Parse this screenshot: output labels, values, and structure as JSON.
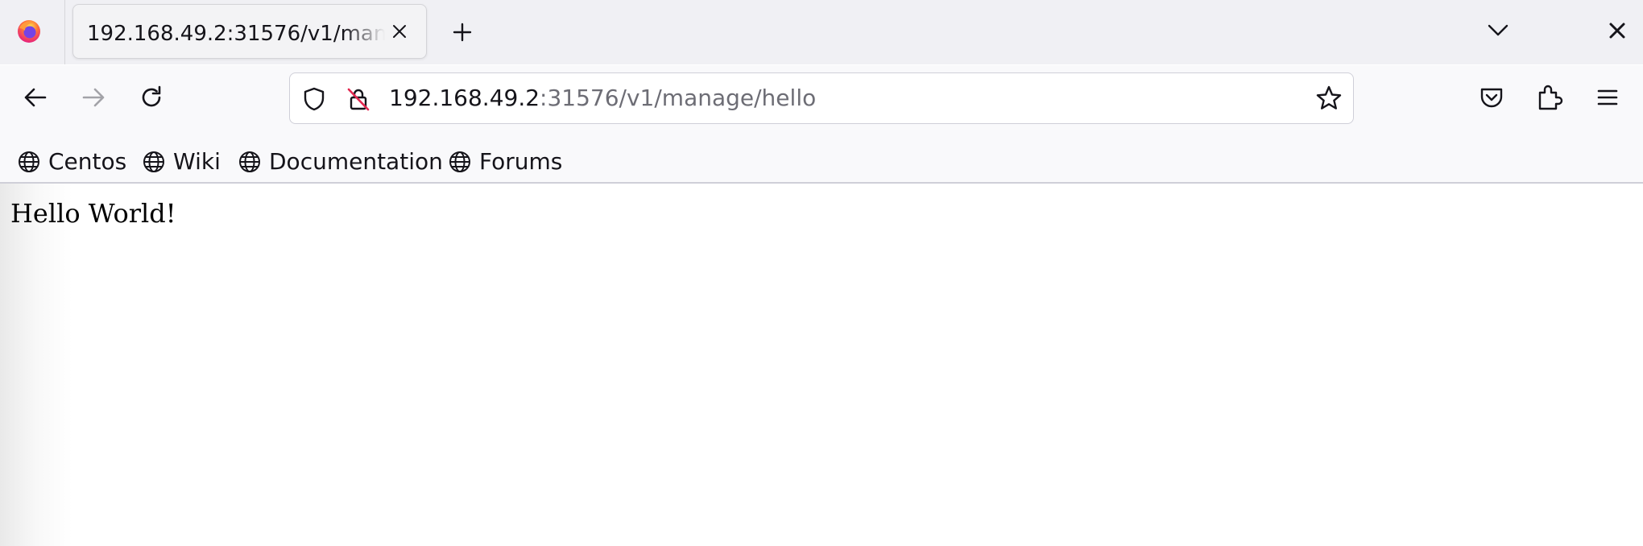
{
  "browser": {
    "app_icon": "firefox-logo",
    "tab": {
      "title": "192.168.49.2:31576/v1/manage/hello",
      "close_icon": "close-icon"
    },
    "new_tab_icon": "plus-icon",
    "list_tabs_icon": "chevron-down-icon",
    "window_close_icon": "close-icon"
  },
  "nav": {
    "back_icon": "back-arrow-icon",
    "forward_icon": "forward-arrow-icon",
    "reload_icon": "reload-icon",
    "url": {
      "host": "192.168.49.2",
      "rest": ":31576/v1/manage/hello"
    },
    "shield_icon": "tracking-protection-shield-icon",
    "insecure_icon": "insecure-lock-icon",
    "bookmark_star_icon": "star-icon",
    "pocket_icon": "pocket-icon",
    "extensions_icon": "puzzle-piece-icon",
    "menu_icon": "hamburger-menu-icon"
  },
  "bookmarks": [
    {
      "label": "Centos",
      "icon": "globe-icon"
    },
    {
      "label": "Wiki",
      "icon": "globe-icon"
    },
    {
      "label": "Documentation",
      "icon": "globe-icon"
    },
    {
      "label": "Forums",
      "icon": "globe-icon"
    }
  ],
  "content": {
    "text": "Hello World!"
  },
  "colors": {
    "tabstrip_bg": "#f0f0f4",
    "toolbar_bg": "#f9f9fb",
    "url_path_gray": "#6d6d75",
    "insecure_red": "#e22850",
    "text": "#15141a"
  }
}
